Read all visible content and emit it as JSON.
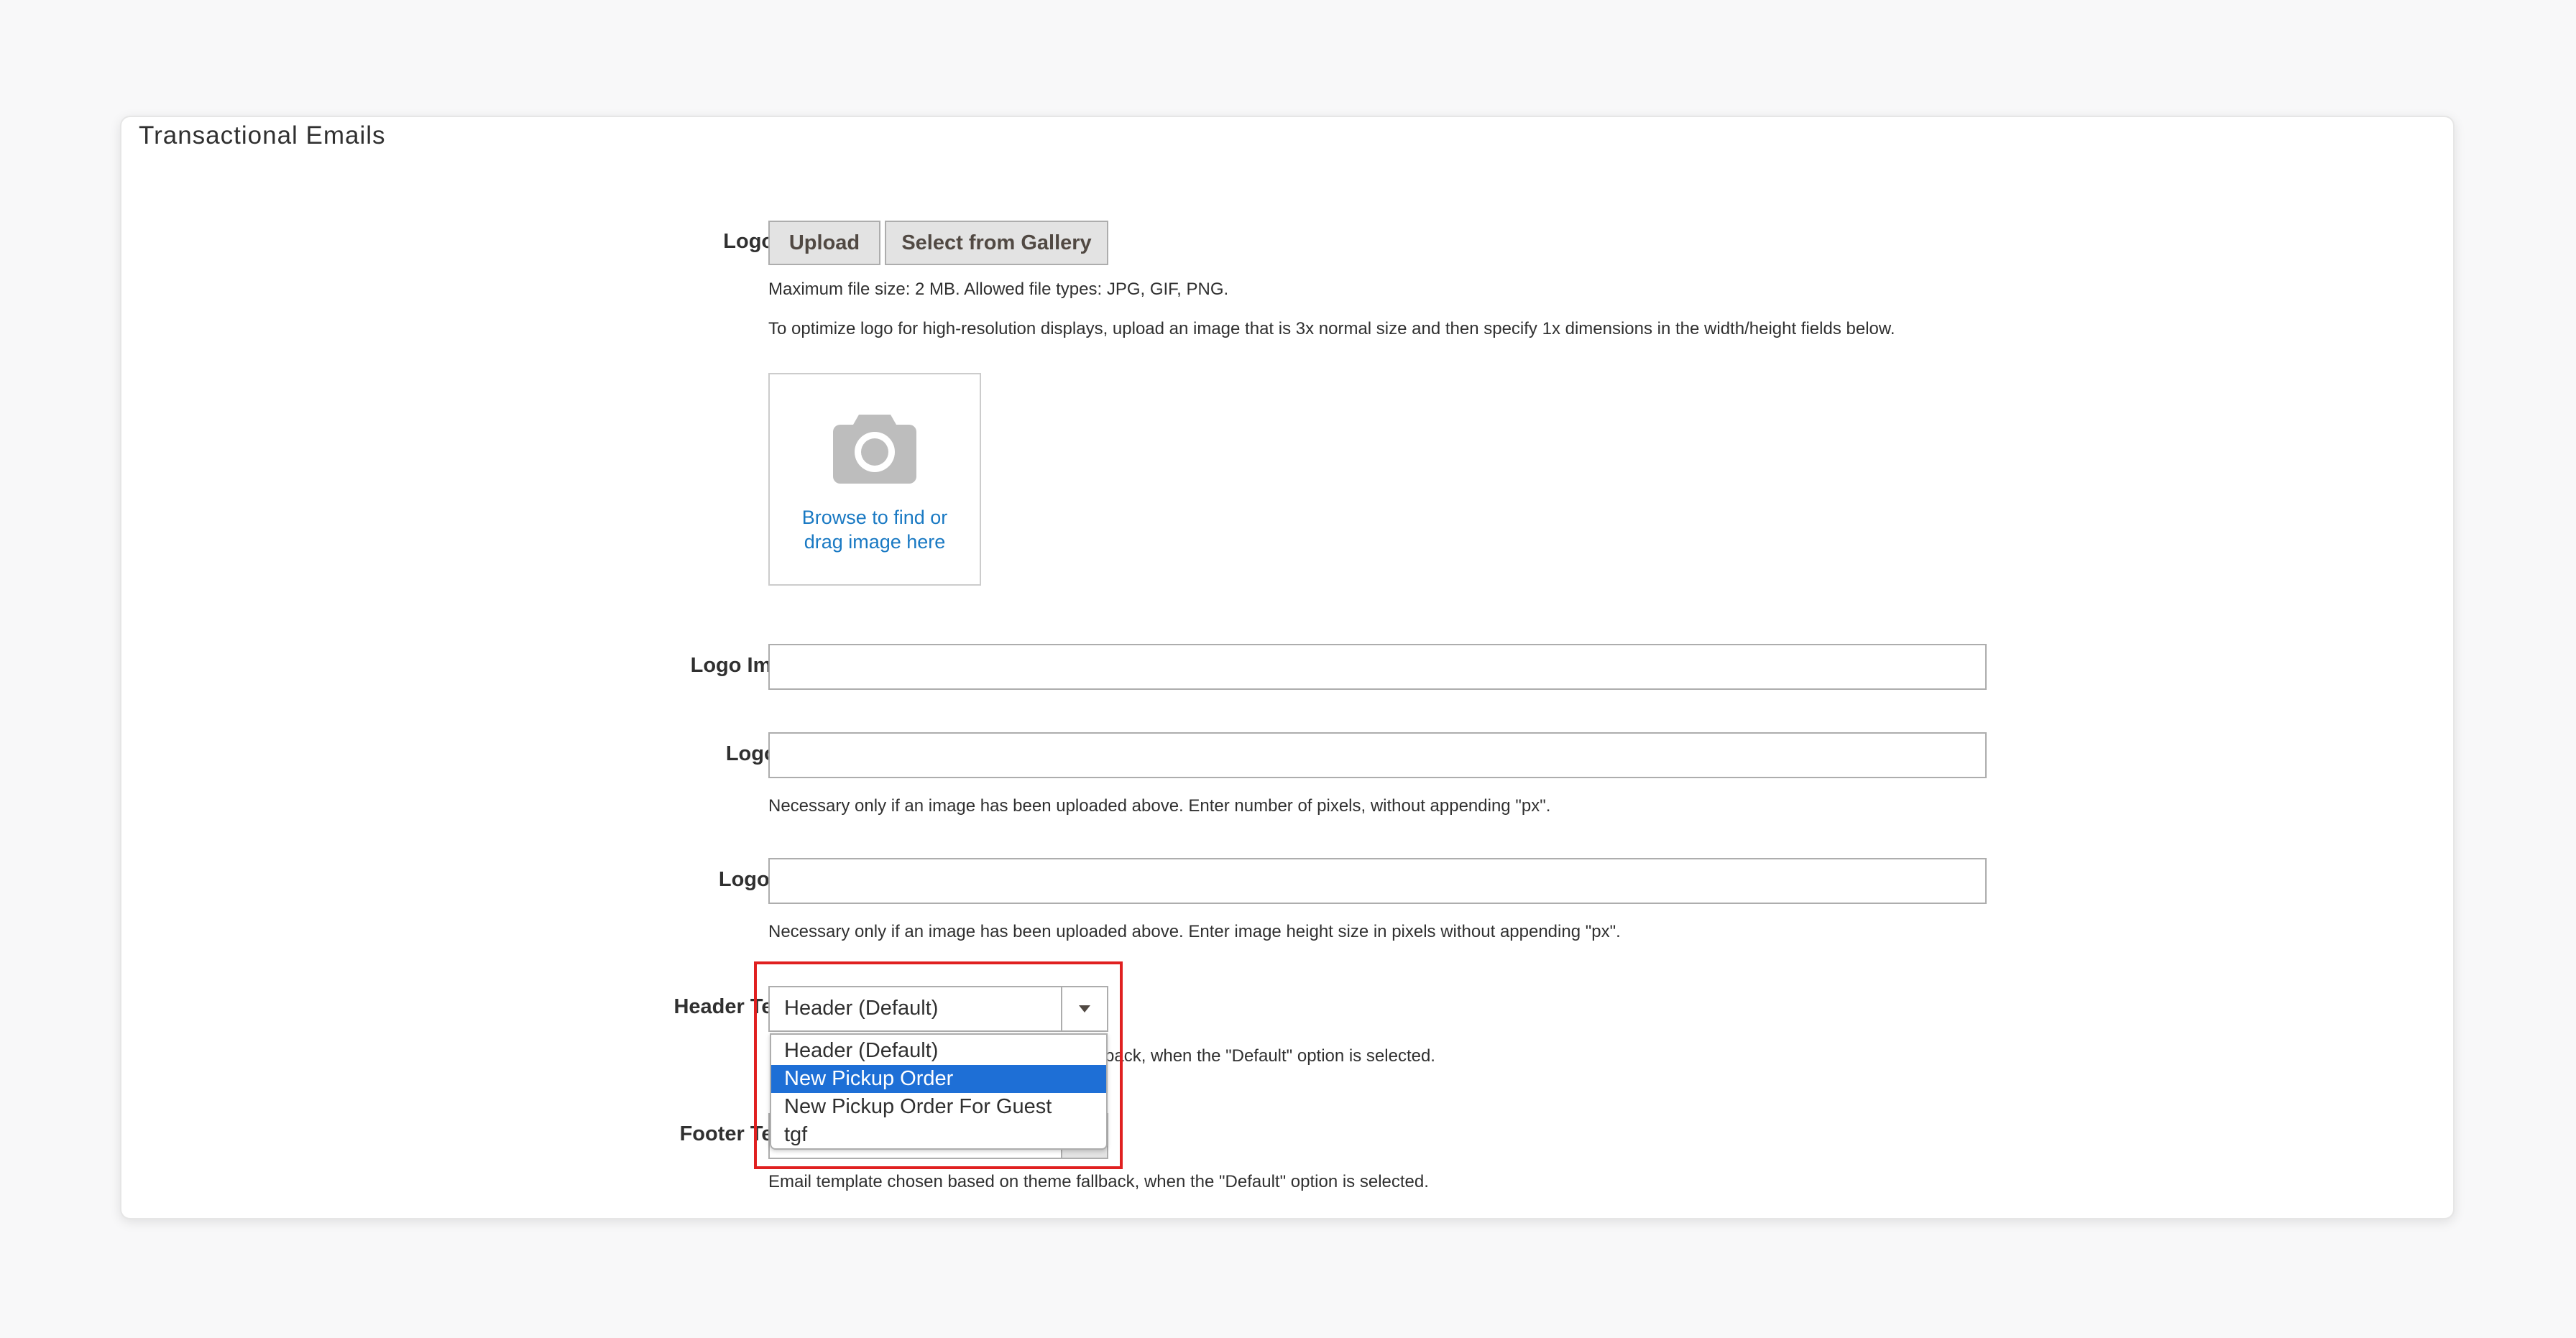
{
  "section": {
    "title": "Transactional Emails"
  },
  "logo_image": {
    "label": "Logo Image",
    "upload_label": "Upload",
    "gallery_label": "Select from Gallery",
    "note_size": "Maximum file size: 2 MB. Allowed file types: JPG, GIF, PNG.",
    "note_optimize": "To optimize logo for high-resolution displays, upload an image that is 3x normal size and then specify 1x dimensions in the width/height fields below.",
    "dropzone_text": "Browse to find or drag image here",
    "dropzone_icon": "camera-icon"
  },
  "logo_alt": {
    "label": "Logo Image Alt",
    "value": ""
  },
  "logo_width": {
    "label": "Logo Width",
    "value": "",
    "note": "Necessary only if an image has been uploaded above. Enter number of pixels, without appending \"px\"."
  },
  "logo_height": {
    "label": "Logo Height",
    "value": "",
    "note": "Necessary only if an image has been uploaded above. Enter image height size in pixels without appending \"px\"."
  },
  "header_template": {
    "label": "Header Template",
    "selected": "Header (Default)",
    "note_visible": "back, when the \"Default\" option is selected.",
    "options": [
      "Header (Default)",
      "New Pickup Order",
      "New Pickup Order For Guest",
      "tgf"
    ],
    "highlighted_option": "New Pickup Order"
  },
  "footer_template": {
    "label": "Footer Template",
    "note": "Email template chosen based on theme fallback, when the \"Default\" option is selected."
  },
  "colors": {
    "highlight_border": "#e02020",
    "selected_option": "#1e6fd6",
    "link": "#1979c3"
  }
}
